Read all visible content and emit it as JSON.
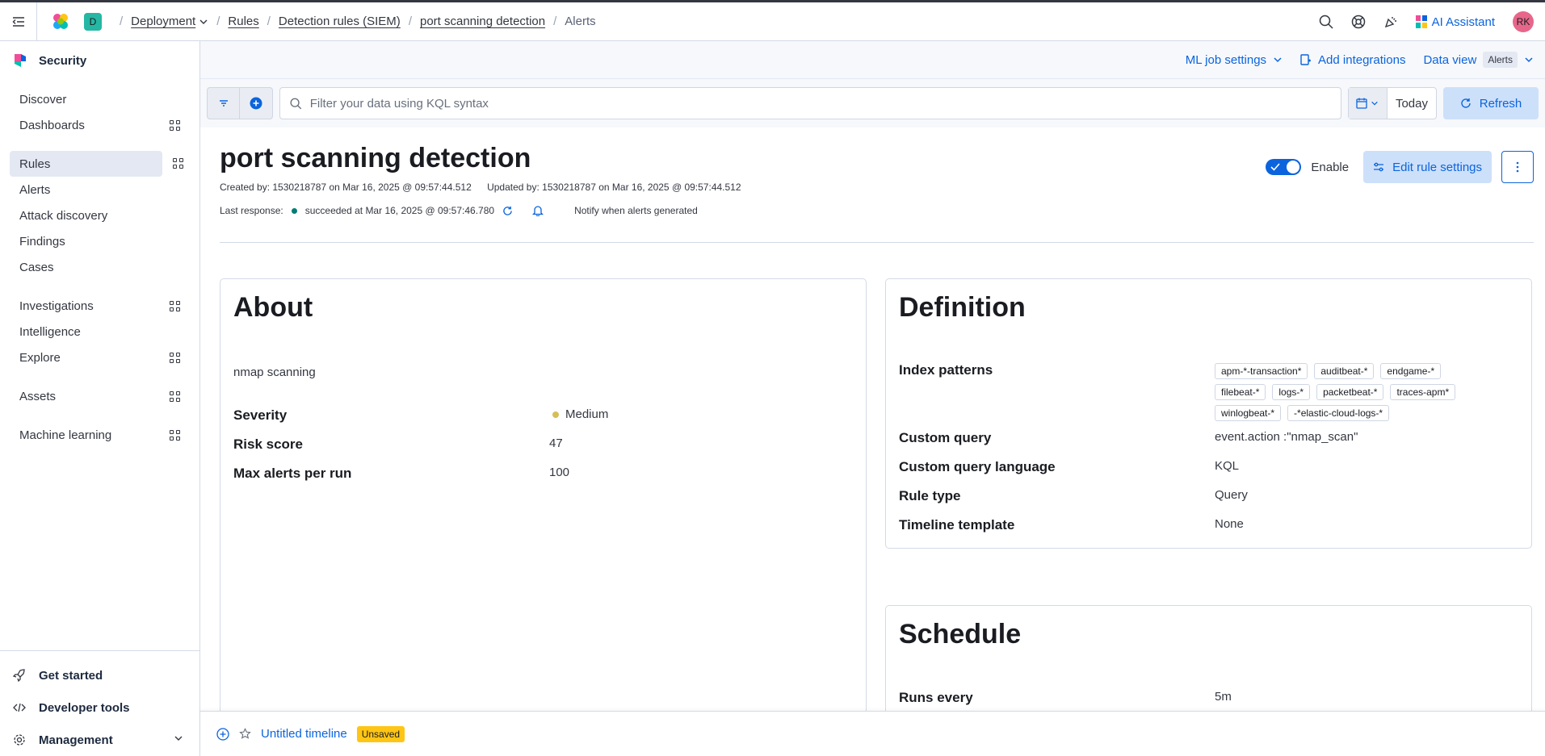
{
  "breadcrumbs": {
    "deployment_badge": "D",
    "items": [
      "Deployment",
      "Rules",
      "Detection rules (SIEM)",
      "port scanning detection",
      "Alerts"
    ]
  },
  "header": {
    "ai_assistant": "AI Assistant",
    "avatar_initials": "RK"
  },
  "sidebar": {
    "title": "Security",
    "items": [
      {
        "label": "Discover"
      },
      {
        "label": "Dashboards"
      },
      {
        "label": "Rules"
      },
      {
        "label": "Alerts"
      },
      {
        "label": "Attack discovery"
      },
      {
        "label": "Findings"
      },
      {
        "label": "Cases"
      },
      {
        "label": "Investigations"
      },
      {
        "label": "Intelligence"
      },
      {
        "label": "Explore"
      },
      {
        "label": "Assets"
      },
      {
        "label": "Machine learning"
      }
    ],
    "bottom": {
      "get_started": "Get started",
      "developer_tools": "Developer tools",
      "management": "Management"
    }
  },
  "subbar": {
    "ml_job_settings": "ML job settings",
    "add_integrations": "Add integrations",
    "data_view_label": "Data view",
    "data_view_value": "Alerts"
  },
  "querybar": {
    "placeholder": "Filter your data using KQL syntax",
    "date_label": "Today",
    "refresh_label": "Refresh"
  },
  "rule": {
    "title": "port scanning detection",
    "created": "Created by: 1530218787 on Mar 16, 2025 @ 09:57:44.512",
    "updated": "Updated by: 1530218787 on Mar 16, 2025 @ 09:57:44.512",
    "last_response_label": "Last response:",
    "last_response_value": "succeeded at Mar 16, 2025 @ 09:57:46.780",
    "notify": "Notify when alerts generated",
    "enable_label": "Enable",
    "edit_label": "Edit rule settings"
  },
  "about": {
    "title": "About",
    "description": "nmap scanning",
    "severity_label": "Severity",
    "severity_value": "Medium",
    "risk_label": "Risk score",
    "risk_value": "47",
    "max_alerts_label": "Max alerts per run",
    "max_alerts_value": "100"
  },
  "definition": {
    "title": "Definition",
    "index_label": "Index patterns",
    "index_patterns": [
      "apm-*-transaction*",
      "auditbeat-*",
      "endgame-*",
      "filebeat-*",
      "logs-*",
      "packetbeat-*",
      "traces-apm*",
      "winlogbeat-*",
      "-*elastic-cloud-logs-*"
    ],
    "query_label": "Custom query",
    "query_value": "event.action :\"nmap_scan\"",
    "language_label": "Custom query language",
    "language_value": "KQL",
    "type_label": "Rule type",
    "type_value": "Query",
    "timeline_label": "Timeline template",
    "timeline_value": "None"
  },
  "schedule": {
    "title": "Schedule",
    "runs_label": "Runs every",
    "runs_value": "5m"
  },
  "timeline": {
    "title": "Untitled timeline",
    "badge": "Unsaved"
  }
}
